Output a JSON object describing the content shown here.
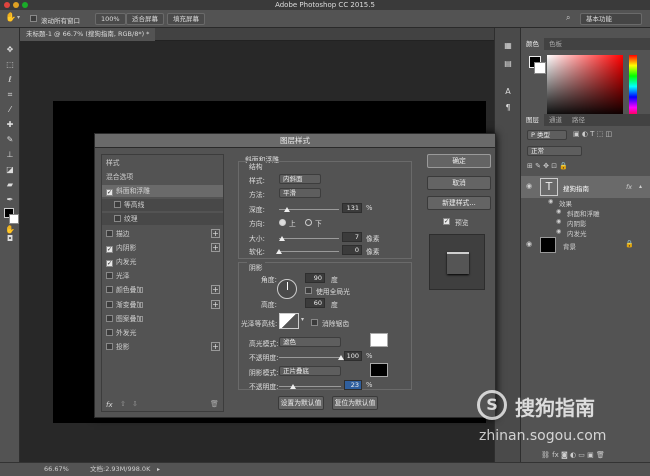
{
  "app": {
    "title": "Adobe Photoshop CC 2015.5"
  },
  "options_bar": {
    "scroll_all_label": "滚动所有窗口",
    "zoom_100_label": "100%",
    "fit_screen_label": "适合屏幕",
    "fill_screen_label": "填充屏幕",
    "workspace_label": "基本功能"
  },
  "document": {
    "tab_label": "未标题-1 @ 66.7% (搜狗指南, RGB/8*) *"
  },
  "status": {
    "zoom": "66.67%",
    "doc_info": "文档:2.93M/998.0K"
  },
  "color_panel": {
    "tabs": [
      "颜色",
      "色板"
    ]
  },
  "layers_panel": {
    "tabs": [
      "图层",
      "通道",
      "路径"
    ],
    "kind_label": "P 类型",
    "blend_mode": "正常",
    "layers": [
      {
        "name": "搜狗指南",
        "fx": "fx"
      },
      {
        "name": "背景"
      }
    ],
    "effects_label": "效果",
    "effects": [
      "斜面和浮雕",
      "内阴影",
      "内发光"
    ]
  },
  "dialog": {
    "title": "图层样式",
    "styles_header": "样式",
    "blend_options": "混合选项",
    "styles": [
      {
        "label": "斜面和浮雕",
        "checked": true,
        "plus": false,
        "indent": false,
        "selected": true
      },
      {
        "label": "等高线",
        "checked": false,
        "plus": false,
        "indent": true
      },
      {
        "label": "纹理",
        "checked": false,
        "plus": false,
        "indent": true
      },
      {
        "label": "描边",
        "checked": false,
        "plus": true,
        "indent": false
      },
      {
        "label": "内阴影",
        "checked": true,
        "plus": true,
        "indent": false
      },
      {
        "label": "内发光",
        "checked": true,
        "plus": false,
        "indent": false
      },
      {
        "label": "光泽",
        "checked": false,
        "plus": false,
        "indent": false
      },
      {
        "label": "颜色叠加",
        "checked": false,
        "plus": true,
        "indent": false
      },
      {
        "label": "渐变叠加",
        "checked": false,
        "plus": true,
        "indent": false
      },
      {
        "label": "图案叠加",
        "checked": false,
        "plus": false,
        "indent": false
      },
      {
        "label": "外发光",
        "checked": false,
        "plus": false,
        "indent": false
      },
      {
        "label": "投影",
        "checked": false,
        "plus": true,
        "indent": false
      }
    ],
    "fx_label": "fx",
    "bevel": {
      "header": "斜面和浮雕",
      "structure_header": "结构",
      "style_label": "样式:",
      "style_value": "内斜面",
      "technique_label": "方法:",
      "technique_value": "平滑",
      "depth_label": "深度:",
      "depth_value": "131",
      "depth_unit": "%",
      "depth_slider": 0.13,
      "direction_label": "方向:",
      "direction_up": "上",
      "direction_down": "下",
      "size_label": "大小:",
      "size_value": "7",
      "size_unit": "像素",
      "size_slider": 0.05,
      "soften_label": "软化:",
      "soften_value": "0",
      "soften_unit": "像素",
      "soften_slider": 0.0
    },
    "shading": {
      "header": "阴影",
      "angle_label": "角度:",
      "angle_value": "90",
      "angle_unit": "度",
      "global_light_label": "使用全局光",
      "altitude_label": "高度:",
      "altitude_value": "60",
      "altitude_unit": "度",
      "gloss_label": "光泽等高线:",
      "antialias_label": "消除锯齿",
      "highlight_mode_label": "高光模式:",
      "highlight_mode_value": "滤色",
      "highlight_color": "#ffffff",
      "highlight_opacity_label": "不透明度:",
      "highlight_opacity_value": "100",
      "highlight_opacity_unit": "%",
      "highlight_opacity_slider": 1.0,
      "shadow_mode_label": "阴影模式:",
      "shadow_mode_value": "正片叠底",
      "shadow_color": "#000000",
      "shadow_opacity_label": "不透明度:",
      "shadow_opacity_value": "23",
      "shadow_opacity_unit": "%",
      "shadow_opacity_slider": 0.23
    },
    "set_default_label": "设置为默认值",
    "reset_default_label": "复位为默认值",
    "ok_label": "确定",
    "cancel_label": "取消",
    "new_style_label": "新建样式...",
    "preview_label": "预览"
  },
  "watermark": {
    "brand": "搜狗指南",
    "url": "zhinan.sogou.com"
  }
}
